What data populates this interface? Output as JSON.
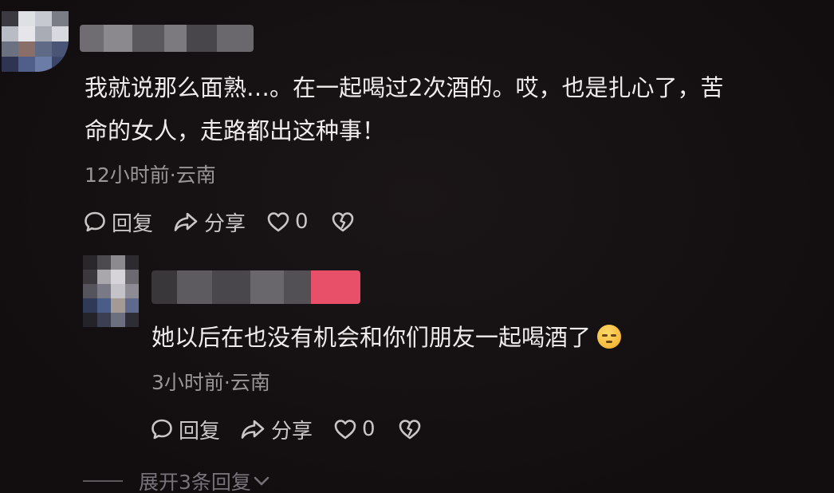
{
  "comments": [
    {
      "text_line_1": "我就说那么面熟…。在一起喝过2次酒的。哎，也是扎心了，苦",
      "text_line_2": "命的女人，走路都出这种事！",
      "meta": "12小时前·云南",
      "actions": {
        "reply_label": "回复",
        "share_label": "分享",
        "like_count": "0"
      }
    },
    {
      "text": "她以后在也没有机会和你们朋友一起喝酒了",
      "meta": "3小时前·云南",
      "actions": {
        "reply_label": "回复",
        "share_label": "分享",
        "like_count": "0"
      }
    }
  ],
  "expand_replies_label": "展开3条回复",
  "icons": {
    "reply": "speech-bubble-icon",
    "share": "share-arrow-icon",
    "like": "heart-outline-icon",
    "dislike": "broken-heart-icon",
    "emoji": "expressionless-face-emoji",
    "expand": "chevron-down-icon"
  },
  "colors": {
    "background": "#141012",
    "text": "#efedec",
    "meta_text": "#9a9697",
    "action_text": "#c9c6c6",
    "expand_text": "#77737a"
  }
}
